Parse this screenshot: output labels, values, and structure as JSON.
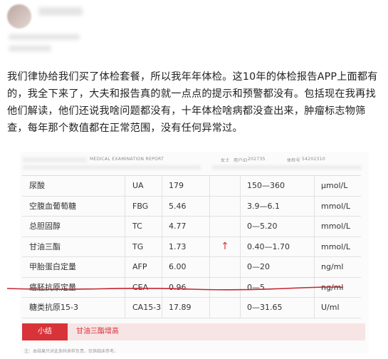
{
  "post": {
    "text": "我们律协给我们买了体检套餐，所以我年年体检。这10年的体检报告APP上面都有的，我全下来了，大夫和报告真的就一点点的提示和预警都没有。包括现在我再找他们解读，他们还说我啥问题都没有，十年体检啥病都没查出来，肿瘤标志物筛查，每年那个数值都在正常范围，没有任何异常过。"
  },
  "report": {
    "title": "MEDICAL EXAMINATION REPORT",
    "gender": "女士",
    "user_id_label": "用户ID",
    "user_id": "202735",
    "exam_no_label": "体检号",
    "exam_no": "54202310",
    "rows": [
      {
        "name": "尿酸",
        "code": "UA",
        "value": "179",
        "flag": "",
        "range": "150—360",
        "unit": "μmol/L"
      },
      {
        "name": "空腹血葡萄糖",
        "code": "FBG",
        "value": "5.46",
        "flag": "",
        "range": "3.9—6.1",
        "unit": "mmol/L"
      },
      {
        "name": "总胆固醇",
        "code": "TC",
        "value": "4.77",
        "flag": "",
        "range": "0—5.20",
        "unit": "mmol/L"
      },
      {
        "name": "甘油三酯",
        "code": "TG",
        "value": "1.73",
        "flag": "↑",
        "range": "0.40—1.70",
        "unit": "mmol/L"
      },
      {
        "name": "甲胎蛋白定量",
        "code": "AFP",
        "value": "6.00",
        "flag": "",
        "range": "0—20",
        "unit": "ng/ml"
      },
      {
        "name": "癌胚抗原定量",
        "code": "CEA",
        "value": "0.96",
        "flag": "",
        "range": "0—5",
        "unit": "ng/ml"
      },
      {
        "name": "糖类抗原15-3",
        "code": "CA15-3",
        "value": "17.89",
        "flag": "",
        "range": "0—31.65",
        "unit": "U/ml"
      }
    ],
    "summary_label": "小结",
    "summary_text": "甘油三酯增高",
    "footnote": "注：本结果只对此条码来样负责，仅供临床参考。"
  },
  "colors": {
    "accent_red": "#d9333a",
    "summary_bg": "#f7e4e4"
  }
}
